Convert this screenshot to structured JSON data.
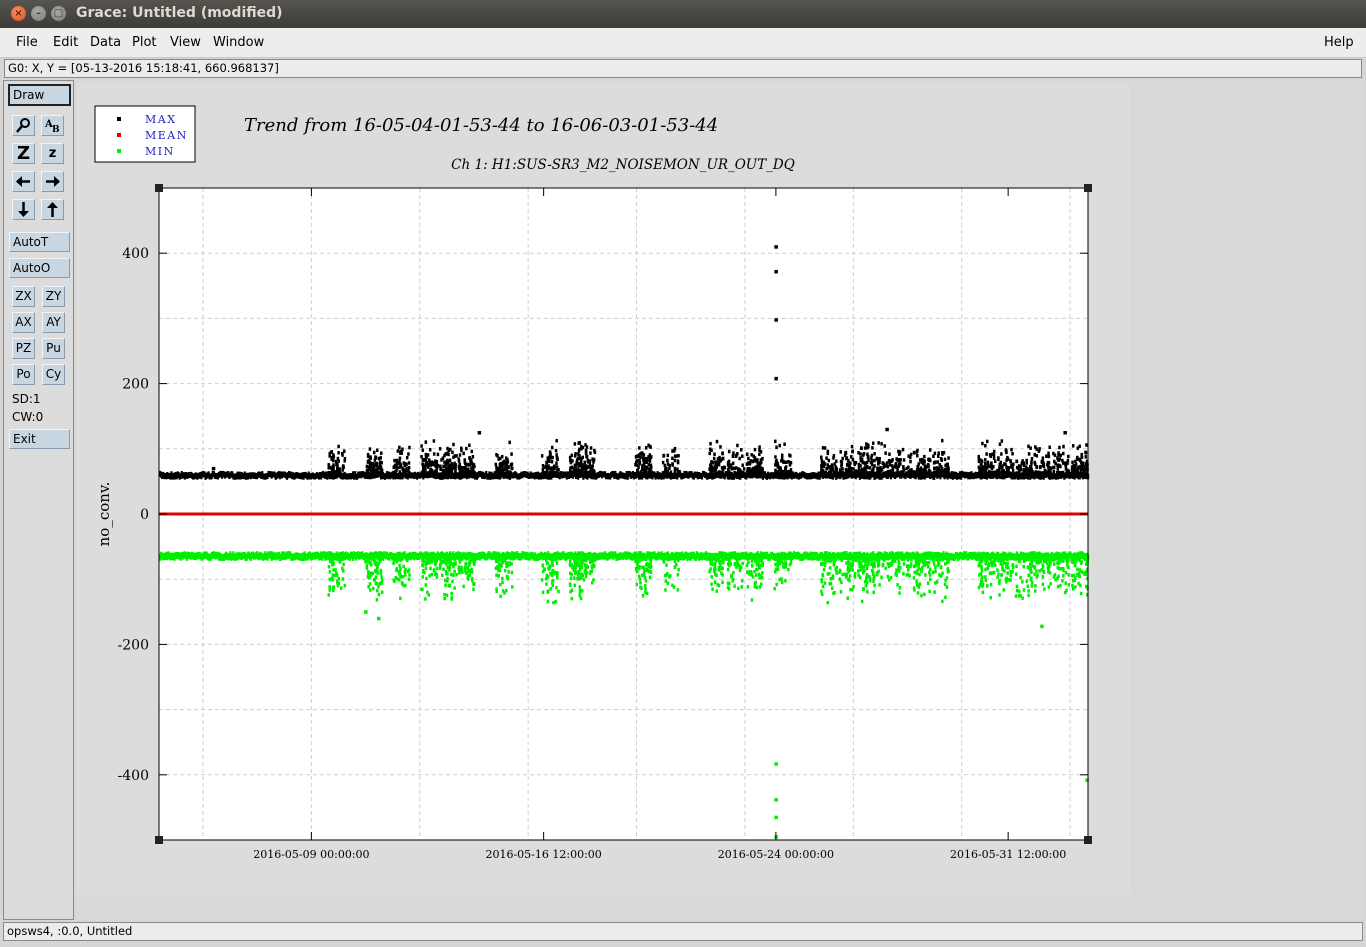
{
  "window": {
    "title": "Grace: Untitled (modified)"
  },
  "menu": {
    "file": "File",
    "edit": "Edit",
    "data": "Data",
    "plot": "Plot",
    "view": "View",
    "window": "Window",
    "help": "Help"
  },
  "locator": "G0: X, Y = [05-13-2016 15:18:41, 660.968137]",
  "toolbar": {
    "draw": "Draw",
    "autot": "AutoT",
    "autoo": "AutoO",
    "zx": "ZX",
    "zy": "ZY",
    "ax": "AX",
    "ay": "AY",
    "pz": "PZ",
    "pu": "Pu",
    "po": "Po",
    "cy": "Cy",
    "sd": "SD:1",
    "cw": "CW:0",
    "exit": "Exit",
    "icons": [
      "magnifier-icon",
      "text-icon",
      "zoom-in-icon",
      "zoom-out-icon",
      "arrow-left-icon",
      "arrow-right-icon",
      "arrow-down-icon",
      "arrow-up-icon"
    ]
  },
  "status": "opsws4, :0.0, Untitled",
  "chart_data": {
    "type": "scatter",
    "title": "Trend from 16-05-04-01-53-44 to 16-06-03-01-53-44",
    "subtitle": "Ch 1: H1:SUS-SR3_M2_NOISEMON_UR_OUT_DQ",
    "xlabel": "",
    "ylabel": "no_conv.",
    "xlim": [
      "2016-05-04 01:53:44",
      "2016-06-03 01:53:44"
    ],
    "ylim": [
      -500,
      500
    ],
    "x_ticks": [
      "2016-05-09 00:00:00",
      "2016-05-16 12:00:00",
      "2016-05-24 00:00:00",
      "2016-05-31 12:00:00"
    ],
    "y_ticks": [
      400,
      200,
      0,
      -200,
      -400
    ],
    "grid": true,
    "legend_position": "top-left outside",
    "series": [
      {
        "name": "MAX",
        "color": "#000000",
        "baseline": 60,
        "points": [
          {
            "x": "2016-05-24 00:00:00",
            "y": 410
          },
          {
            "x": "2016-05-24 00:00:00",
            "y": 372
          },
          {
            "x": "2016-05-24 00:00:00",
            "y": 298
          },
          {
            "x": "2016-05-24 00:00:00",
            "y": 208
          },
          {
            "x": "2016-05-27 14:00:00",
            "y": 130
          },
          {
            "x": "2016-05-14 10:00:00",
            "y": 125
          },
          {
            "x": "2016-06-02 08:00:00",
            "y": 125
          },
          {
            "x": "2016-05-05 20:00:00",
            "y": 70
          }
        ]
      },
      {
        "name": "MEAN",
        "color": "#e00000",
        "baseline": 0,
        "points": []
      },
      {
        "name": "MIN",
        "color": "#00ee00",
        "baseline": -63,
        "points": [
          {
            "x": "2016-05-24 00:00:00",
            "y": -383
          },
          {
            "x": "2016-05-24 00:00:00",
            "y": -438
          },
          {
            "x": "2016-05-24 00:00:00",
            "y": -465
          },
          {
            "x": "2016-05-24 00:00:00",
            "y": -495
          },
          {
            "x": "2016-06-03 01:00:00",
            "y": -408
          },
          {
            "x": "2016-06-01 14:00:00",
            "y": -172
          },
          {
            "x": "2016-05-11 04:00:00",
            "y": -160
          },
          {
            "x": "2016-05-10 18:00:00",
            "y": -150
          }
        ]
      }
    ]
  }
}
